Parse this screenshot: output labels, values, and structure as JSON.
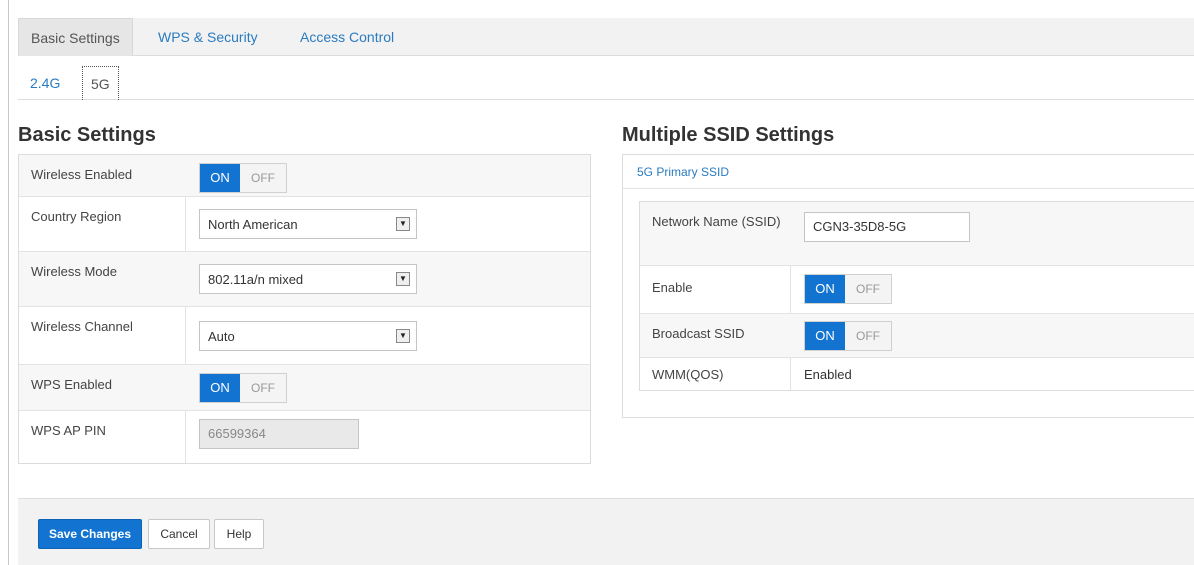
{
  "tabs": [
    {
      "label": "Basic Settings",
      "active": true
    },
    {
      "label": "WPS & Security",
      "active": false
    },
    {
      "label": "Access Control",
      "active": false
    }
  ],
  "band_tabs": [
    {
      "label": "2.4G",
      "active": false
    },
    {
      "label": "5G",
      "active": true
    }
  ],
  "basic": {
    "title": "Basic Settings",
    "wireless_enabled": {
      "label": "Wireless Enabled",
      "on": "ON",
      "off": "OFF",
      "state": "on"
    },
    "country_region": {
      "label": "Country Region",
      "value": "North American"
    },
    "wireless_mode": {
      "label": "Wireless Mode",
      "value": "802.11a/n mixed"
    },
    "wireless_channel": {
      "label": "Wireless Channel",
      "value": "Auto"
    },
    "wps_enabled": {
      "label": "WPS Enabled",
      "on": "ON",
      "off": "OFF",
      "state": "on"
    },
    "wps_ap_pin": {
      "label": "WPS AP PIN",
      "value": "66599364"
    }
  },
  "multi_ssid": {
    "title": "Multiple SSID Settings",
    "primary_label": "5G Primary SSID",
    "network_name": {
      "label": "Network Name (SSID)",
      "value": "CGN3-35D8-5G"
    },
    "enable": {
      "label": "Enable",
      "on": "ON",
      "off": "OFF",
      "state": "on"
    },
    "broadcast": {
      "label": "Broadcast SSID",
      "on": "ON",
      "off": "OFF",
      "state": "on"
    },
    "wmm": {
      "label": "WMM(QOS)",
      "value": "Enabled"
    }
  },
  "footer": {
    "save": "Save Changes",
    "cancel": "Cancel",
    "help": "Help"
  },
  "colors": {
    "accent": "#1274d0",
    "link": "#2a7bc0"
  }
}
